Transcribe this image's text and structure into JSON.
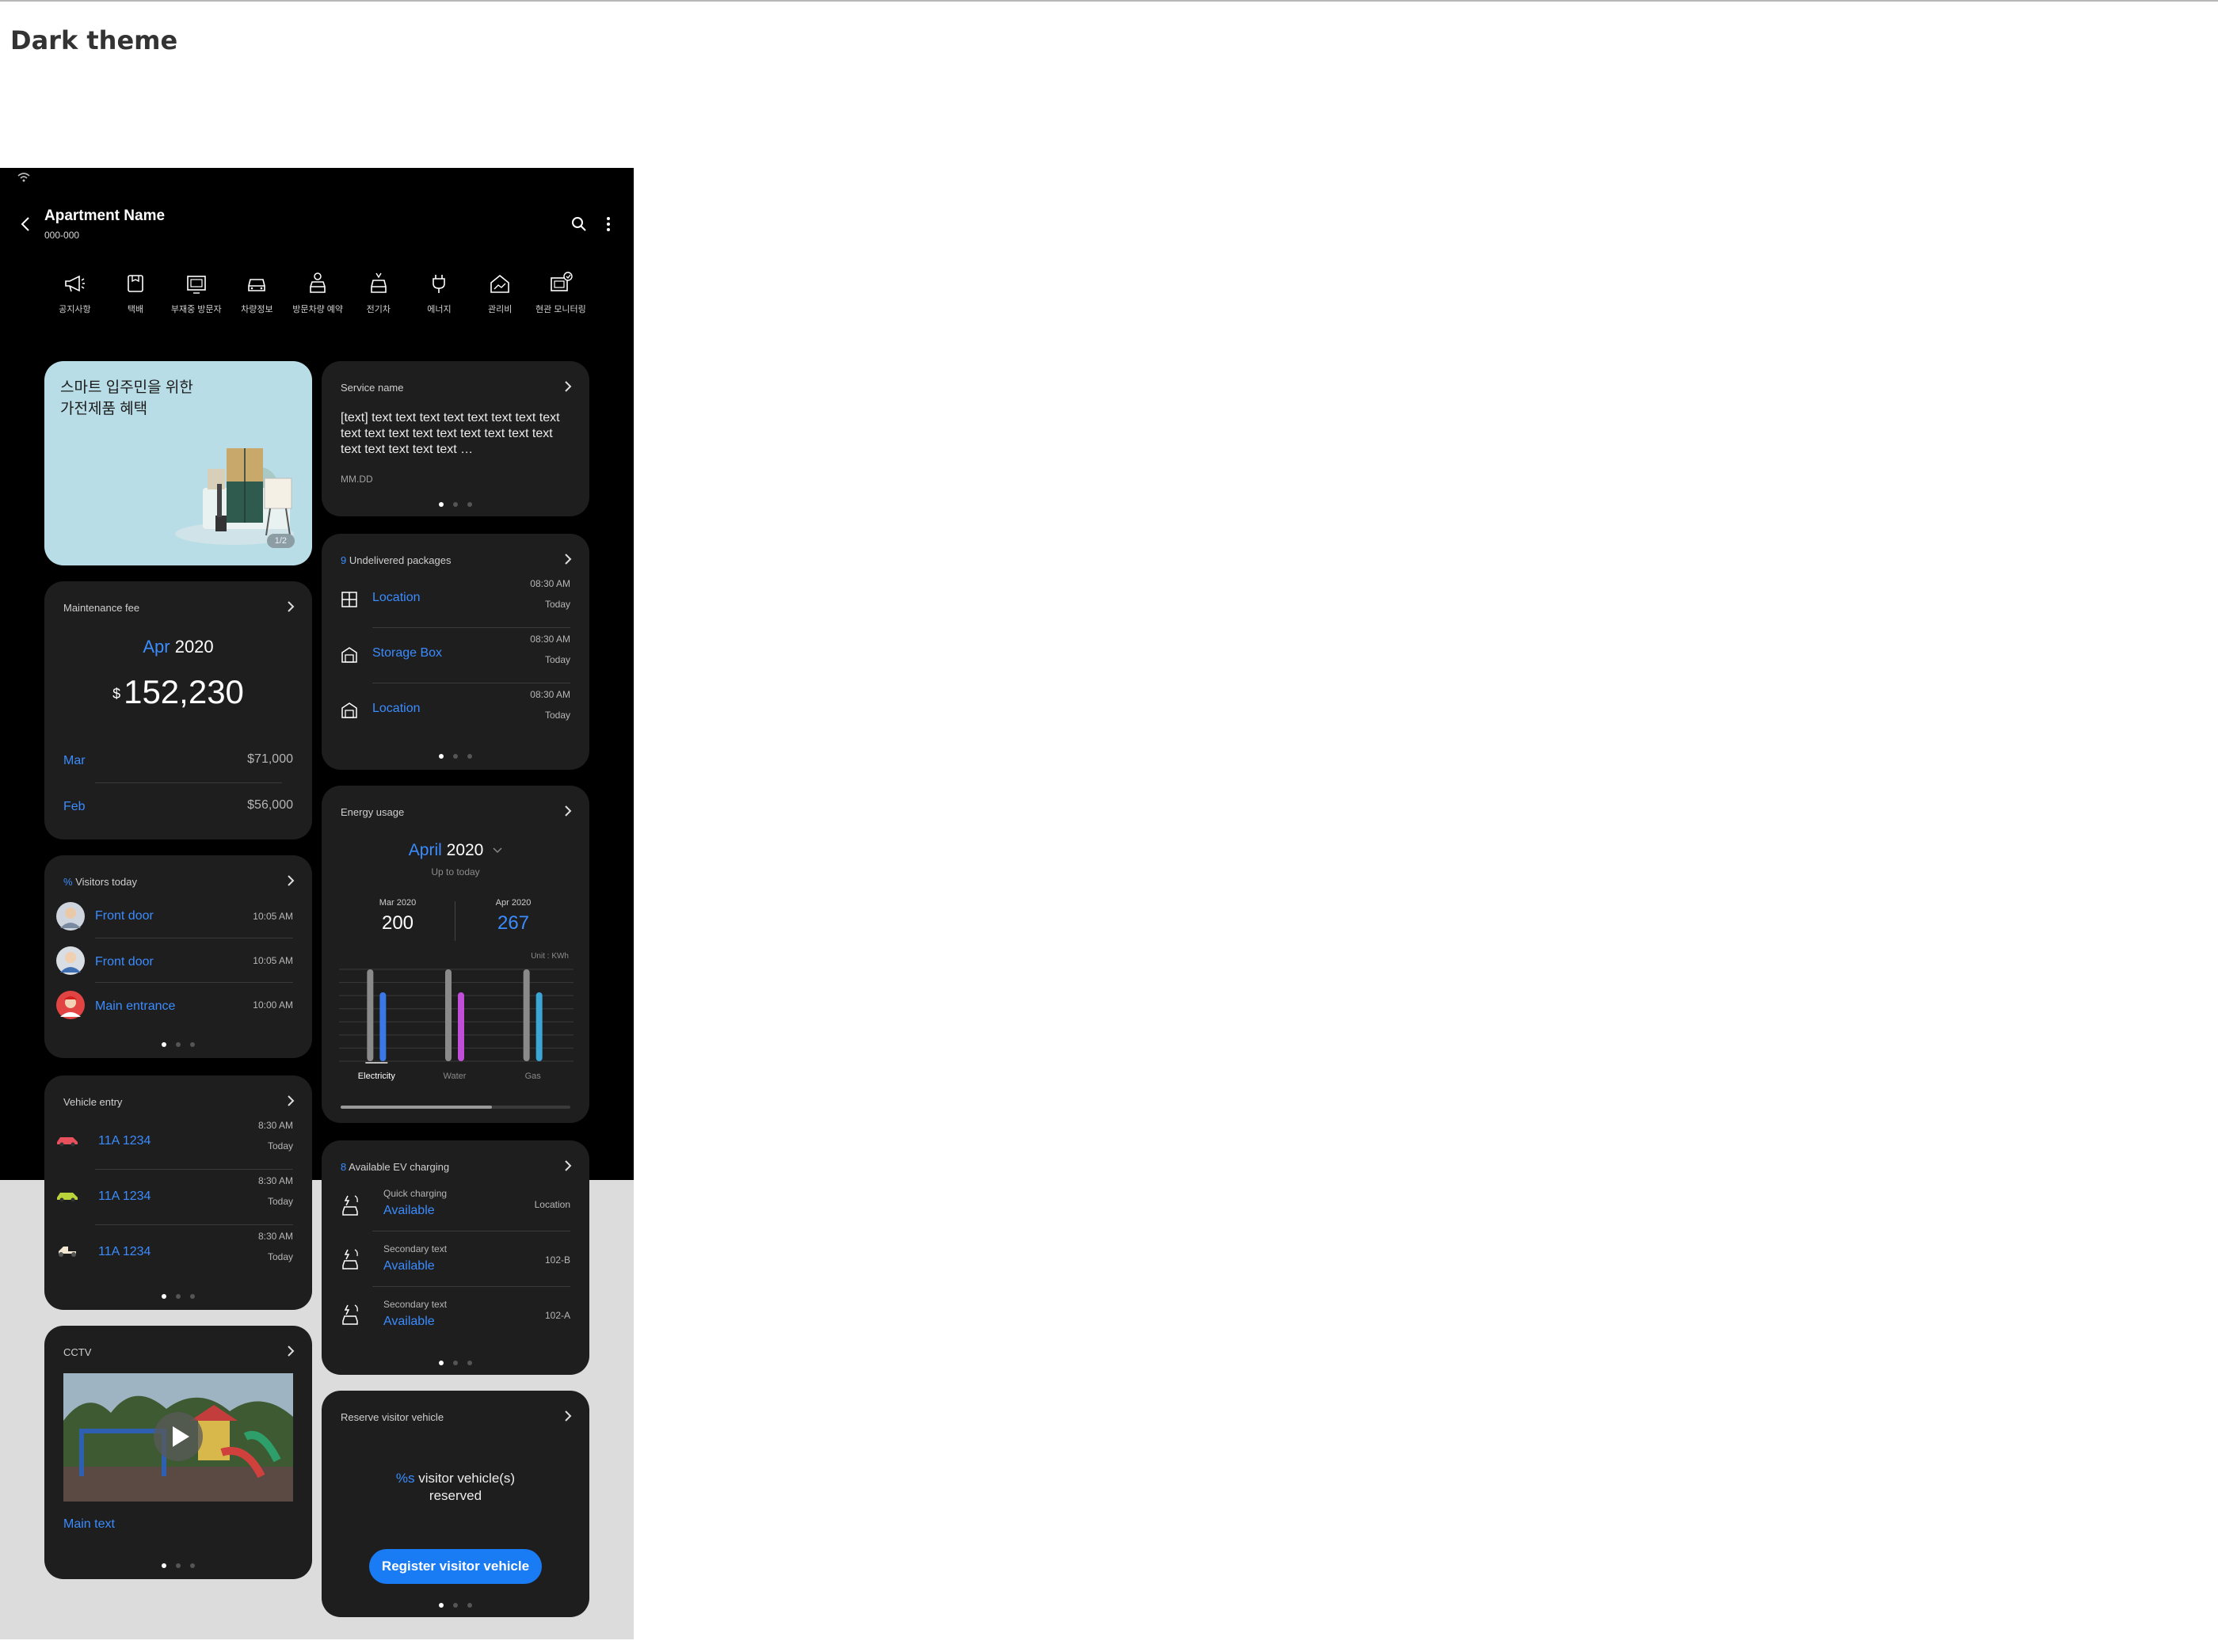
{
  "page": {
    "heading": "Dark theme"
  },
  "appbar": {
    "title": "Apartment Name",
    "subtitle": "000-000"
  },
  "quick_menu": [
    {
      "label": "공지사항",
      "icon": "megaphone-icon"
    },
    {
      "label": "택배",
      "icon": "package-icon"
    },
    {
      "label": "부재중 방문자",
      "icon": "monitor-icon"
    },
    {
      "label": "차량정보",
      "icon": "car-icon"
    },
    {
      "label": "방문차량 예약",
      "icon": "visitor-car-icon"
    },
    {
      "label": "전기차",
      "icon": "ev-car-icon"
    },
    {
      "label": "에너지",
      "icon": "plug-icon"
    },
    {
      "label": "관리비",
      "icon": "house-chart-icon"
    },
    {
      "label": "현관 모니터링",
      "icon": "doorcam-icon"
    }
  ],
  "promo": {
    "line1": "스마트 입주민을 위한",
    "line2": "가전제품 혜택",
    "page": "1/2"
  },
  "service": {
    "title": "Service name",
    "body": "[text] text text text text text text text text text text text text text text text text text text text text text text …",
    "date": "MM.DD"
  },
  "packages": {
    "count": "9",
    "title": "Undelivered packages",
    "rows": [
      {
        "label": "Location",
        "time": "08:30 AM",
        "day": "Today"
      },
      {
        "label": "Storage Box",
        "time": "08:30 AM",
        "day": "Today"
      },
      {
        "label": "Location",
        "time": "08:30 AM",
        "day": "Today"
      }
    ]
  },
  "maintenance": {
    "title": "Maintenance fee",
    "month": "Apr",
    "year": "2020",
    "currency": "$",
    "amount": "152,230",
    "history": [
      {
        "month": "Mar",
        "amount": "$71,000"
      },
      {
        "month": "Feb",
        "amount": "$56,000"
      }
    ]
  },
  "visitors": {
    "count": "%",
    "title": "Visitors today",
    "rows": [
      {
        "label": "Front door",
        "time": "10:05 AM"
      },
      {
        "label": "Front door",
        "time": "10:05 AM"
      },
      {
        "label": "Main entrance",
        "time": "10:00 AM"
      }
    ]
  },
  "vehicles": {
    "title": "Vehicle entry",
    "rows": [
      {
        "plate": "11A 1234",
        "time": "8:30 AM",
        "day": "Today",
        "color": "#e8505b"
      },
      {
        "plate": "11A 1234",
        "time": "8:30 AM",
        "day": "Today",
        "color": "#b8d43a"
      },
      {
        "plate": "11A 1234",
        "time": "8:30 AM",
        "day": "Today",
        "color": "#f2e8d2"
      }
    ]
  },
  "cctv": {
    "title": "CCTV",
    "main_text": "Main text"
  },
  "energy": {
    "title": "Energy usage",
    "month": "April",
    "year": "2020",
    "sub": "Up to today",
    "prev_label": "Mar 2020",
    "prev_value": "200",
    "cur_label": "Apr 2020",
    "cur_value": "267",
    "unit": "Unit : KWh"
  },
  "chart_data": {
    "type": "bar",
    "categories": [
      "Electricity",
      "Water",
      "Gas"
    ],
    "series": [
      {
        "values": [
          100,
          100,
          100
        ],
        "color": "#8a8a8a"
      },
      {
        "values": [
          75,
          75,
          75
        ],
        "colors": [
          "#3b78e7",
          "#c04ed8",
          "#3ba5d4"
        ]
      }
    ],
    "ylim": [
      0,
      100
    ],
    "grid": true
  },
  "ev": {
    "count": "8",
    "title": "Available EV charging",
    "rows": [
      {
        "primary": "Quick charging",
        "status": "Available",
        "loc": "Location"
      },
      {
        "primary": "Secondary text",
        "status": "Available",
        "loc": "102-B"
      },
      {
        "primary": "Secondary text",
        "status": "Available",
        "loc": "102-A"
      }
    ]
  },
  "reserve": {
    "title": "Reserve visitor vehicle",
    "count": "%s",
    "line1": " visitor vehicle(s)",
    "line2": "reserved",
    "button": "Register visitor vehicle"
  },
  "colors": {
    "accent": "#3b8cff",
    "card": "#1e1e1e",
    "button": "#1a7cf5"
  }
}
